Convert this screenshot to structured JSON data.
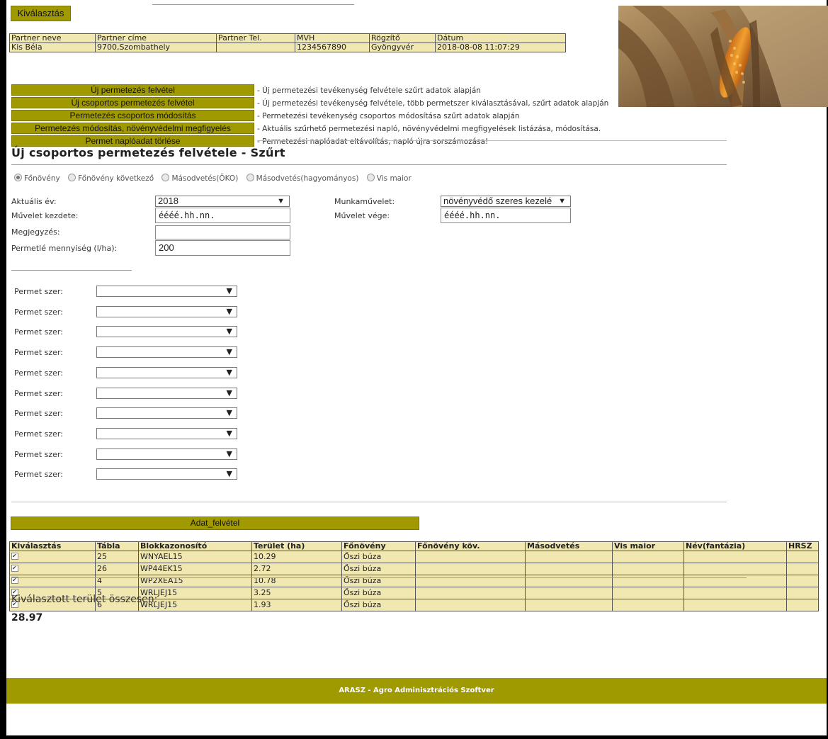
{
  "top": {
    "select_button": "Kiválasztás"
  },
  "partner_table": {
    "headers": [
      "Partner neve",
      "Partner címe",
      "Partner Tel.",
      "MVH",
      "Rögzítő",
      "Dátum"
    ],
    "row": [
      "Kis Béla",
      "9700,Szombathely",
      "",
      "1234567890",
      "Gyöngyvér",
      "2018-08-08 11:07:29"
    ]
  },
  "menu": [
    {
      "label": "Új permetezés felvétel",
      "desc": "- Új permetezési tevékenység felvétele szűrt adatok alapján"
    },
    {
      "label": "Új csoportos permetezés felvétel",
      "desc": "- Új permetezési tevékenység felvétele, több permetszer kiválasztásával, szűrt adatok alapján"
    },
    {
      "label": "Permetezés csoportos módosítás",
      "desc": "- Permetezési tevékenység csoportos módosítása szűrt adatok alapján"
    },
    {
      "label": "Permetezés módosítás, növényvédelmi megfigyelés",
      "desc": "- Aktuális szűrhető permetezési napló, növényvédelmi megfigyelések listázása, módosítása."
    },
    {
      "label": "Permet naplóadat törlése",
      "desc": "- Permetezési naplóadat eltávolítás, napló újra sorszámozása!"
    }
  ],
  "page_title": "Új csoportos permetezés felvétele - Szűrt",
  "radios": [
    {
      "label": "Főnövény",
      "checked": true
    },
    {
      "label": "Főnövény következő",
      "checked": false
    },
    {
      "label": "Másodvetés(ÖKO)",
      "checked": false
    },
    {
      "label": "Másodvetés(hagyományos)",
      "checked": false
    },
    {
      "label": "Vis maior",
      "checked": false
    }
  ],
  "form": {
    "year_label": "Aktuális év:",
    "year_value": "2018",
    "work_label": "Munkaművelet:",
    "work_value": "növényvédő szeres kezelé",
    "start_label": "Művelet kezdete:",
    "start_placeholder": "éééé.hh.nn.",
    "end_label": "Művelet vége:",
    "end_placeholder": "éééé.hh.nn.",
    "note_label": "Megjegyzés:",
    "note_value": "",
    "spray_amount_label": "Permetlé mennyiség (l/ha):",
    "spray_amount_value": "200"
  },
  "permet_label": "Permet szer:",
  "permet_count": 10,
  "adat_button": "Adat_felvétel",
  "tabla": {
    "headers": [
      "Kiválasztás",
      "Tábla",
      "Blokkazonosító",
      "Terület (ha)",
      "Főnövény",
      "Főnövény köv.",
      "Másodvetés",
      "Vis maior",
      "Név(fantázia)",
      "HRSZ"
    ],
    "rows": [
      [
        "25",
        "WNYAEL15",
        "10.29",
        "Őszi búza"
      ],
      [
        "26",
        "WP44EK15",
        "2.72",
        "Őszi búza"
      ],
      [
        "4",
        "WP2XEA15",
        "10.78",
        "Őszi búza"
      ],
      [
        "5",
        "WRLJEJ15",
        "3.25",
        "Őszi búza"
      ],
      [
        "6",
        "WRLJEJ15",
        "1.93",
        "Őszi búza"
      ]
    ]
  },
  "summary": {
    "label": "Kiválasztott terület összesen:",
    "value": "28.97"
  },
  "footer": "ARASZ - Agro Adminisztrációs Szoftver"
}
